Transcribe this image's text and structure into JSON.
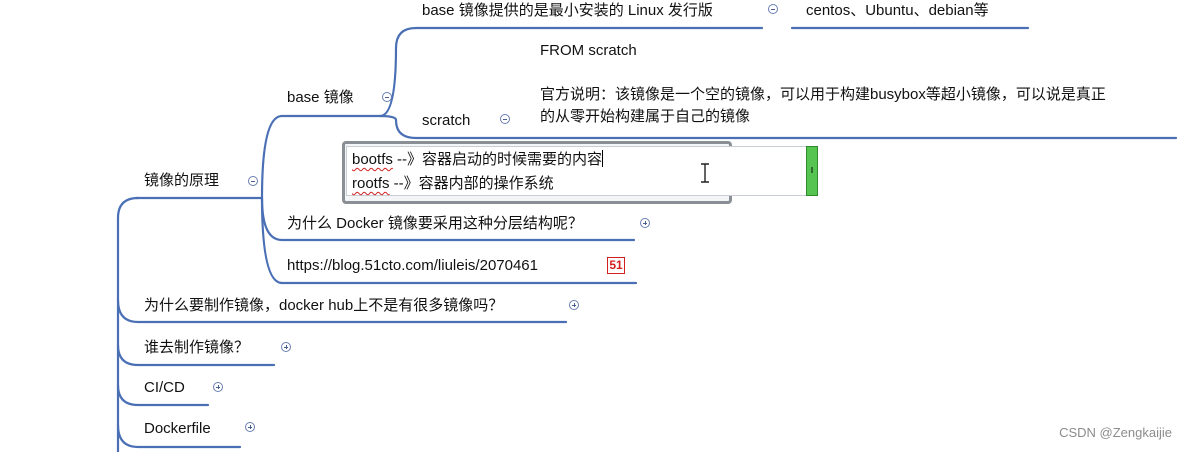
{
  "mindmap": {
    "root_topic": "镜像的原理",
    "base_image": {
      "label": "base 镜像",
      "minimal_distro": {
        "label": "base 镜像提供的是最小安装的 Linux 发行版",
        "child": "centos、Ubuntu、debian等"
      },
      "scratch": {
        "label": "scratch",
        "note_line1": "FROM scratch",
        "note_line2": "官方说明：该镜像是一个空的镜像，可以用于构建busybox等超小镜像，可以说是真正",
        "note_line3": "的从零开始构建属于自己的镜像"
      }
    },
    "editor": {
      "bootfs_word": "bootfs",
      "bootfs_rest": " --》容器启动的时候需要的内容",
      "rootfs_word": "rootfs",
      "rootfs_rest": " --》容器内部的操作系统"
    },
    "why_layered": "为什么 Docker 镜像要采用这种分层结构呢？",
    "link": "https://blog.51cto.com/liuleis/2070461",
    "link_badge": "51",
    "why_make_image": "为什么要制作镜像，docker hub上不是有很多镜像吗？",
    "who_makes": "谁去制作镜像？",
    "cicd": "CI/CD",
    "dockerfile": "Dockerfile"
  },
  "watermark": "CSDN @Zengkaijie",
  "colors": {
    "branch_line": "#4a6fb5",
    "toggle_border": "#6a7fb0",
    "squiggle": "#d21f1f",
    "scroll_strip": "#56c451",
    "badge": "#d31f1f"
  },
  "icons": {
    "collapse": "minus-circle-icon",
    "expand": "plus-circle-icon",
    "cursor": "i-beam-cursor-icon"
  }
}
